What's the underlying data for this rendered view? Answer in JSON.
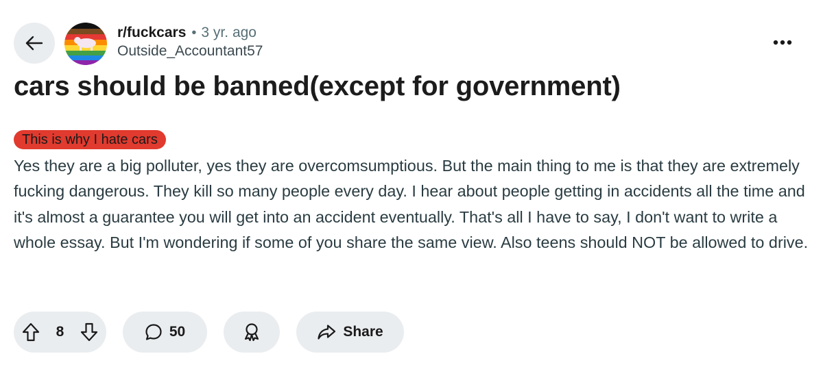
{
  "post": {
    "subreddit": "r/fuckcars",
    "separator": "•",
    "time_ago": "3 yr. ago",
    "author": "Outside_Accountant57",
    "title": "cars should be banned(except for government)",
    "flair": "This is why I hate cars",
    "body": "Yes they are a big polluter, yes they are overcomsumptious. But the main thing to me is that they are extremely fucking dangerous. They kill so many people every day. I hear about people getting in accidents all the time and it's almost a guarantee you will get into an accident eventually. That's all I have to say, I don't want to write a whole essay. But I'm wondering if some of you share the same view. Also teens should NOT be allowed to drive."
  },
  "actions": {
    "vote_count": "8",
    "comment_count": "50",
    "share_label": "Share"
  },
  "icons": {
    "back": "arrow-left-icon",
    "more": "more-horizontal-icon",
    "upvote": "upvote-arrow-icon",
    "downvote": "downvote-arrow-icon",
    "comment": "comment-bubble-icon",
    "award": "award-ribbon-icon",
    "share": "share-arrow-icon"
  },
  "colors": {
    "flair_background": "#e13a2e",
    "pill_background": "#eaedef",
    "body_text": "#2a3c42",
    "meta_text": "#576f76"
  }
}
